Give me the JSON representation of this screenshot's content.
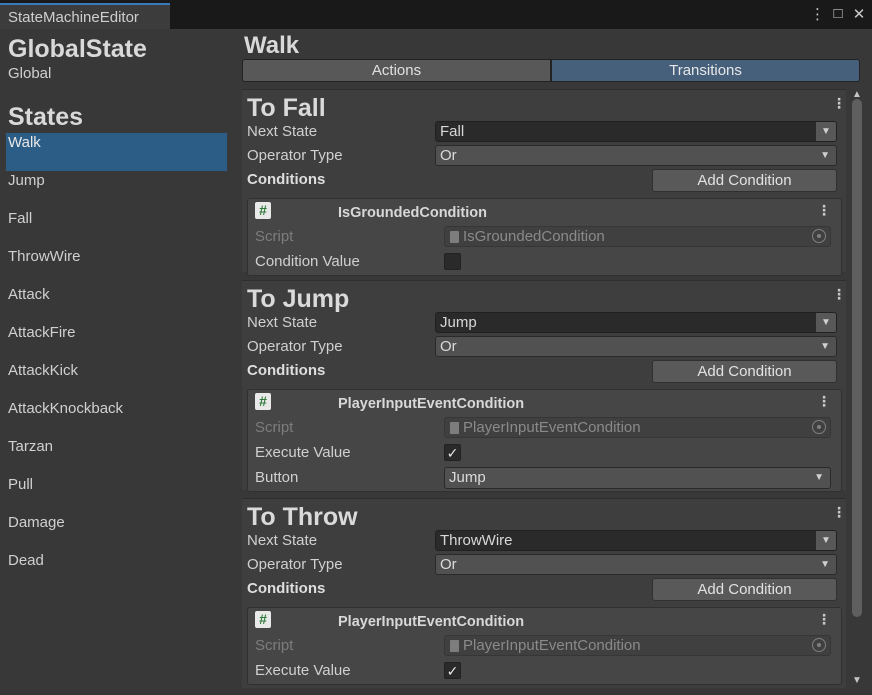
{
  "window": {
    "tab_title": "StateMachineEditor",
    "kebab": "⋮",
    "maximize": "□",
    "close": "✕"
  },
  "left": {
    "global_title": "GlobalState",
    "global_sub": "Global",
    "states_title": "States",
    "states": [
      "Walk",
      "Jump",
      "Fall",
      "ThrowWire",
      "Attack",
      "AttackFire",
      "AttackKick",
      "AttackKnockback",
      "Tarzan",
      "Pull",
      "Damage",
      "Dead"
    ],
    "selected_state": "Walk"
  },
  "right": {
    "title": "Walk",
    "tabs": {
      "actions": "Actions",
      "transitions": "Transitions"
    },
    "active_tab": "Transitions",
    "labels": {
      "next_state": "Next State",
      "operator_type": "Operator Type",
      "conditions": "Conditions",
      "add_condition": "Add Condition",
      "script": "Script"
    },
    "transitions": [
      {
        "title": "To Fall",
        "next_state": "Fall",
        "operator_type": "Or",
        "condition": {
          "name": "IsGroundedCondition",
          "script": "IsGroundedCondition",
          "field_label": "Condition Value",
          "checked": false
        }
      },
      {
        "title": "To Jump",
        "next_state": "Jump",
        "operator_type": "Or",
        "condition": {
          "name": "PlayerInputEventCondition",
          "script": "PlayerInputEventCondition",
          "field_label": "Execute Value",
          "checked": true,
          "button_label": "Button",
          "button_value": "Jump"
        }
      },
      {
        "title": "To Throw",
        "next_state": "ThrowWire",
        "operator_type": "Or",
        "condition": {
          "name": "PlayerInputEventCondition",
          "script": "PlayerInputEventCondition",
          "field_label": "Execute Value",
          "checked": true
        }
      }
    ]
  },
  "colors": {
    "selected": "#2c5d87",
    "tab_active": "#46607c",
    "tab_accent": "#3a79bb"
  }
}
